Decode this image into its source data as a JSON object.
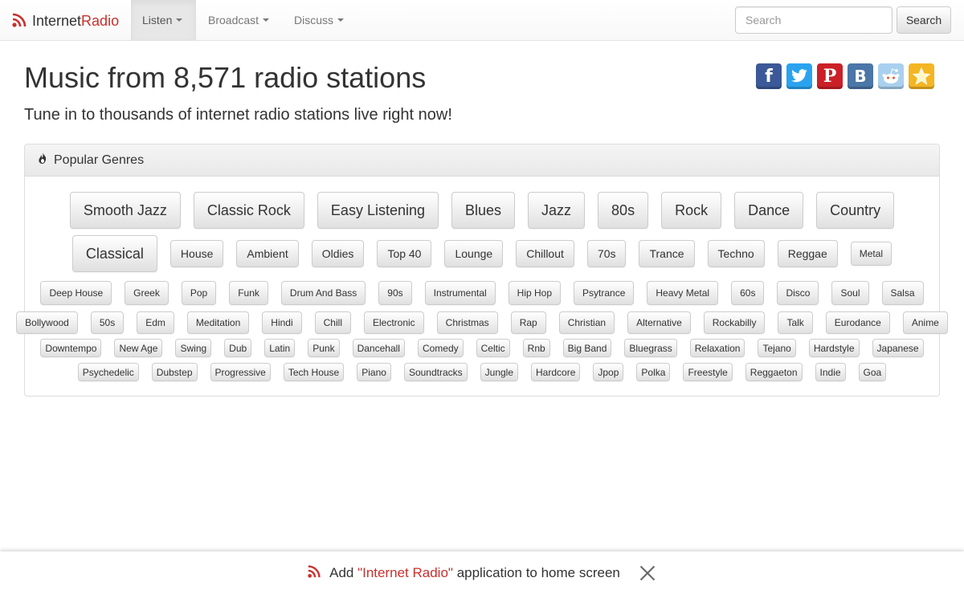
{
  "navbar": {
    "brand_prefix": "Internet",
    "brand_suffix": "Radio",
    "items": [
      {
        "label": "Listen"
      },
      {
        "label": "Broadcast"
      },
      {
        "label": "Discuss"
      }
    ],
    "search_placeholder": "Search",
    "search_button": "Search"
  },
  "header": {
    "title": "Music from 8,571 radio stations",
    "subtitle": "Tune in to thousands of internet radio stations live right now!"
  },
  "share": {
    "icons": [
      "facebook-icon",
      "twitter-icon",
      "pinterest-icon",
      "vk-icon",
      "reddit-icon",
      "favorite-star-icon"
    ],
    "colors": {
      "facebook": "#3b5998",
      "twitter": "#2aa3ef",
      "pinterest": "#cb2027",
      "vk": "#4a76a8",
      "reddit": "#a9d0ee",
      "star": "#f5b623"
    }
  },
  "genres_panel": {
    "heading": "Popular Genres",
    "row1": [
      "Smooth Jazz",
      "Classic Rock",
      "Easy Listening",
      "Blues",
      "Jazz",
      "80s",
      "Rock",
      "Dance",
      "Country"
    ],
    "row2": [
      "Classical",
      "House",
      "Ambient",
      "Oldies",
      "Top 40",
      "Lounge",
      "Chillout",
      "70s",
      "Trance",
      "Techno",
      "Reggae",
      "Metal"
    ],
    "row3": [
      "Deep House",
      "Greek",
      "Pop",
      "Funk",
      "Drum And Bass",
      "90s",
      "Instrumental",
      "Hip Hop",
      "Psytrance",
      "Heavy Metal",
      "60s",
      "Disco",
      "Soul",
      "Salsa"
    ],
    "row4": [
      "Bollywood",
      "50s",
      "Edm",
      "Meditation",
      "Hindi",
      "Chill",
      "Electronic",
      "Christmas",
      "Rap",
      "Christian",
      "Alternative",
      "Rockabilly",
      "Talk",
      "Eurodance",
      "Anime"
    ],
    "row5": [
      "Downtempo",
      "New Age",
      "Swing",
      "Dub",
      "Latin",
      "Punk",
      "Dancehall",
      "Comedy",
      "Celtic",
      "Rnb",
      "Big Band",
      "Bluegrass",
      "Relaxation",
      "Tejano",
      "Hardstyle",
      "Japanese"
    ],
    "row6": [
      "Psychedelic",
      "Dubstep",
      "Progressive",
      "Tech House",
      "Piano",
      "Soundtracks",
      "Jungle",
      "Hardcore",
      "Jpop",
      "Polka",
      "Freestyle",
      "Reggaeton",
      "Indie",
      "Goa"
    ]
  },
  "install_bar": {
    "prefix": "Add",
    "app_name": "\"Internet Radio\"",
    "suffix": "application to home screen"
  }
}
